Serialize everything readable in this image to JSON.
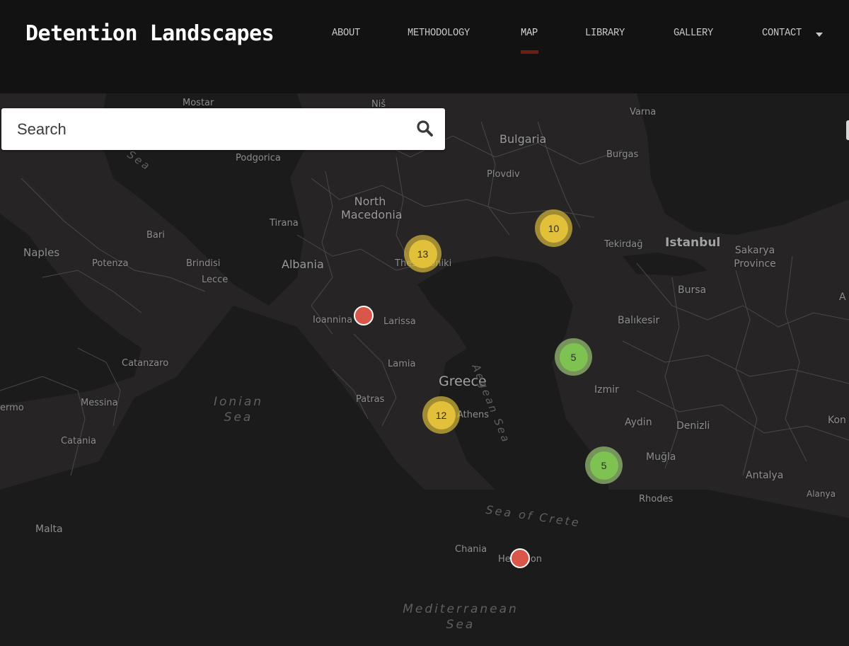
{
  "header": {
    "brand": "Detention Landscapes",
    "nav": [
      {
        "label": "ABOUT",
        "active": false
      },
      {
        "label": "METHODOLOGY",
        "active": false
      },
      {
        "label": "MAP",
        "active": true
      },
      {
        "label": "LIBRARY",
        "active": false
      },
      {
        "label": "GALLERY",
        "active": false
      },
      {
        "label": "CONTACT",
        "active": false,
        "has_dropdown": true
      }
    ],
    "accent_color": "#6d1e14"
  },
  "search": {
    "placeholder": "Search",
    "icon": "search-icon"
  },
  "map": {
    "places": {
      "countries": [
        "Bulgaria",
        "North Macedonia",
        "Albania",
        "Greece"
      ],
      "cities": [
        "Mostar",
        "Niš",
        "Varna",
        "Burgas",
        "Podgorica",
        "Plovdiv",
        "Tirana",
        "Bari",
        "Naples",
        "Potenza",
        "Brindisi",
        "Lecce",
        "Thessaloniki",
        "Tekirdağ",
        "Istanbul",
        "Sakarya Province",
        "Bursa",
        "Ioannina",
        "Larissa",
        "Balıkesir",
        "Lamia",
        "Catanzaro",
        "Patras",
        "Izmir",
        "Messina",
        "Athens",
        "Aydin",
        "Denizli",
        "Catania",
        "Muğla",
        "Antalya",
        "Alanya",
        "Rhodes",
        "Malta",
        "Chania",
        "Heraklion",
        "Kon",
        "ermo",
        "A"
      ],
      "seas": [
        "Aegean Sea",
        "Ionian Sea",
        "Sea of Crete",
        "Mediterranean Sea",
        "Sea"
      ]
    },
    "clusters": [
      {
        "count": "13",
        "location": "Thessaloniki",
        "color": "yellow"
      },
      {
        "count": "10",
        "location": "Edirne region",
        "color": "yellow"
      },
      {
        "count": "12",
        "location": "Athens",
        "color": "yellow"
      },
      {
        "count": "5",
        "location": "Lesbos",
        "color": "green"
      },
      {
        "count": "5",
        "location": "Kos",
        "color": "green"
      }
    ],
    "points": [
      {
        "location": "Ioannina",
        "color": "#d9574a"
      },
      {
        "location": "Heraklion",
        "color": "#d9574a"
      }
    ],
    "colors": {
      "cluster_yellow": "#e2c03a",
      "cluster_green": "#7ec251",
      "point_red": "#d9574a"
    }
  }
}
